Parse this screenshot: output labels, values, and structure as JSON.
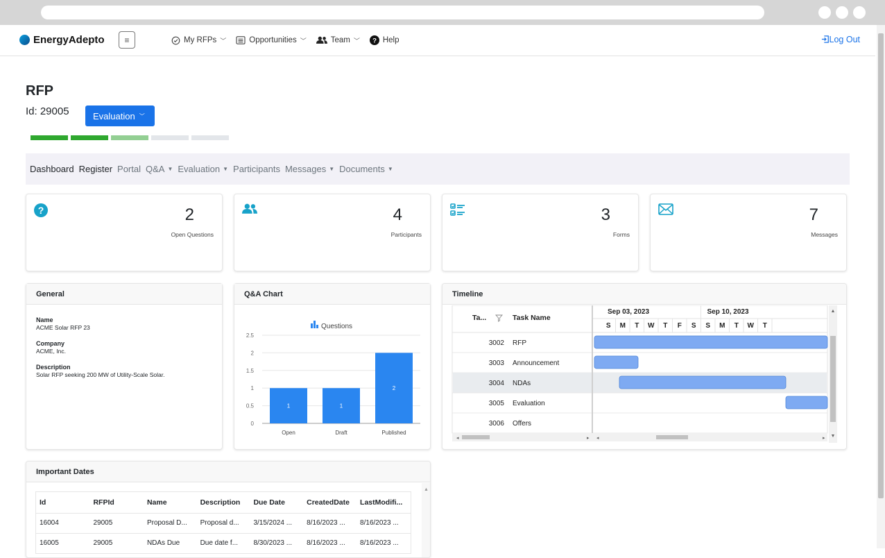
{
  "brand": {
    "name": "EnergyAdepto"
  },
  "nav": {
    "menu_glyph": "≡",
    "items": [
      {
        "label": "My RFPs",
        "icon": "check-circle-icon",
        "dropdown": true
      },
      {
        "label": "Opportunities",
        "icon": "list-box-icon",
        "dropdown": true
      },
      {
        "label": "Team",
        "icon": "people-icon",
        "dropdown": true
      },
      {
        "label": "Help",
        "icon": "question-circle-icon",
        "dropdown": false
      }
    ],
    "logout": "Log Out"
  },
  "page": {
    "title": "RFP",
    "id_label": "Id: 29005",
    "status_button": "Evaluation",
    "progress": [
      {
        "state": "done",
        "color": "#2fa82f"
      },
      {
        "state": "done",
        "color": "#2fa82f"
      },
      {
        "state": "current",
        "color": "#93cf93"
      },
      {
        "state": "todo",
        "color": "#e3e6ea"
      },
      {
        "state": "todo",
        "color": "#e3e6ea"
      }
    ]
  },
  "subnav": [
    {
      "label": "Dashboard",
      "dropdown": false,
      "active": true
    },
    {
      "label": "Register",
      "dropdown": false,
      "active": true
    },
    {
      "label": "Portal",
      "dropdown": false,
      "active": false
    },
    {
      "label": "Q&A",
      "dropdown": true,
      "active": false
    },
    {
      "label": "Evaluation",
      "dropdown": true,
      "active": false
    },
    {
      "label": "Participants",
      "dropdown": false,
      "active": false
    },
    {
      "label": "Messages",
      "dropdown": true,
      "active": false
    },
    {
      "label": "Documents",
      "dropdown": true,
      "active": false
    }
  ],
  "stats": [
    {
      "value": "2",
      "label": "Open Questions",
      "icon": "question-circle-icon"
    },
    {
      "value": "4",
      "label": "Participants",
      "icon": "people-icon"
    },
    {
      "value": "3",
      "label": "Forms",
      "icon": "checklist-icon"
    },
    {
      "value": "7",
      "label": "Messages",
      "icon": "envelope-icon"
    }
  ],
  "general": {
    "title": "General",
    "fields": [
      {
        "key": "Name",
        "value": "ACME Solar RFP 23"
      },
      {
        "key": "Company",
        "value": "ACME, Inc."
      },
      {
        "key": "Description",
        "value": "Solar RFP seeking 200 MW of Utility-Scale Solar."
      }
    ]
  },
  "qa_chart": {
    "title": "Q&A Chart"
  },
  "chart_data": {
    "type": "bar",
    "legend": "Questions",
    "legend_position": "top",
    "categories": [
      "Open",
      "Draft",
      "Published"
    ],
    "values": [
      1,
      1,
      2
    ],
    "ylim": [
      0,
      2.5
    ],
    "yticks": [
      "0",
      "0.5",
      "1",
      "1.5",
      "2",
      "2.5"
    ],
    "grid": true,
    "color": "#2a86f0"
  },
  "timeline": {
    "title": "Timeline",
    "col_id": "Ta...",
    "col_name": "Task Name",
    "weeks": [
      "Sep 03, 2023",
      "Sep 10, 2023"
    ],
    "days": [
      "S",
      "M",
      "T",
      "W",
      "T",
      "F",
      "S",
      "S",
      "M",
      "T",
      "W",
      "T"
    ],
    "tasks": [
      {
        "id": "3002",
        "name": "RFP"
      },
      {
        "id": "3003",
        "name": "Announcement"
      },
      {
        "id": "3004",
        "name": "NDAs"
      },
      {
        "id": "3005",
        "name": "Evaluation"
      },
      {
        "id": "3006",
        "name": "Offers"
      }
    ],
    "bar_color": "#7eaaf2"
  },
  "dates": {
    "title": "Important Dates",
    "columns": [
      "Id",
      "RFPId",
      "Name",
      "Description",
      "Due Date",
      "CreatedDate",
      "LastModifi..."
    ],
    "rows": [
      [
        "16004",
        "29005",
        "Proposal D...",
        "Proposal d...",
        "3/15/2024 ...",
        "8/16/2023 ...",
        "8/16/2023 ..."
      ],
      [
        "16005",
        "29005",
        "NDAs Due",
        "Due date f...",
        "8/30/2023 ...",
        "8/16/2023 ...",
        "8/16/2023 ..."
      ]
    ]
  }
}
